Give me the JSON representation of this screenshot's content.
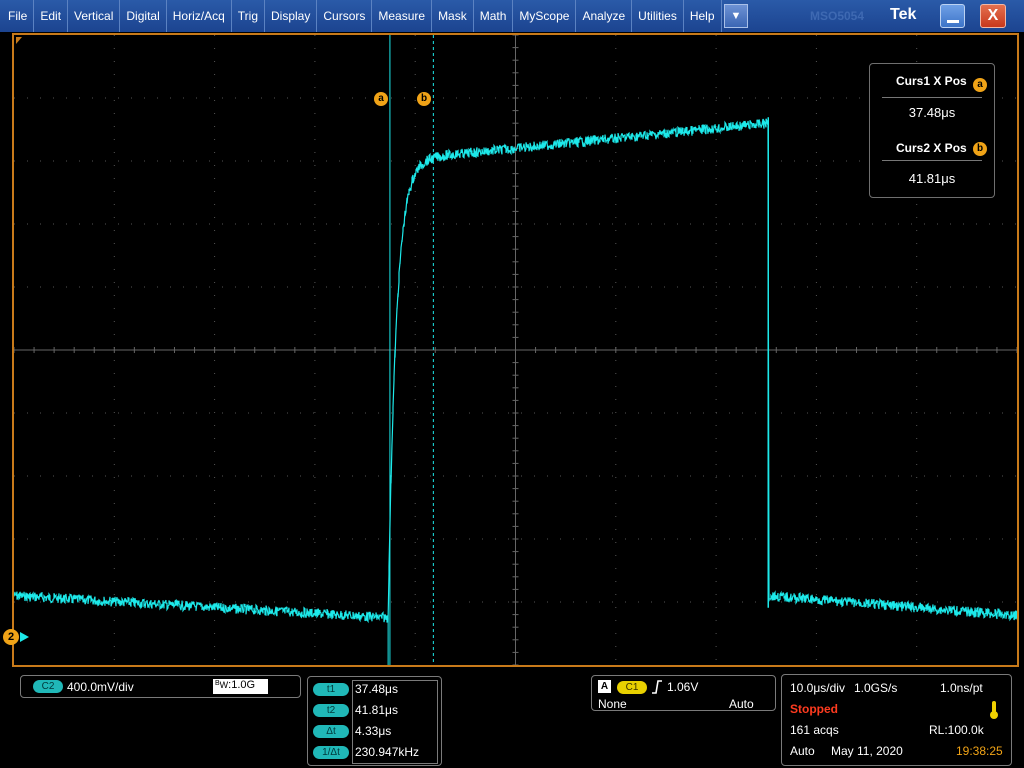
{
  "menu": {
    "items": [
      "File",
      "Edit",
      "Vertical",
      "Digital",
      "Horiz/Acq",
      "Trig",
      "Display",
      "Cursors",
      "Measure",
      "Mask",
      "Math",
      "MyScope",
      "Analyze",
      "Utilities",
      "Help"
    ],
    "dropdown_icon": "chevron-down-icon",
    "brand": "Tek",
    "brand_ghost": "MSO5054"
  },
  "colors": {
    "trace": "#1de9ea",
    "cursor_badge": "#f0a317",
    "border": "#c87a1a",
    "stopped": "#ff3b1f",
    "time": "#f0a317"
  },
  "cursors": {
    "a_label": "a",
    "b_label": "b",
    "curs1_title": "Curs1 X Pos",
    "curs1_value": "37.48μs",
    "curs2_title": "Curs2 X Pos",
    "curs2_value": "41.81μs"
  },
  "channel": {
    "marker": "2",
    "tag": "C2",
    "scale": "400.0mV/div",
    "bw_prefix": "B",
    "bw_sub": "W",
    "bw_value": ":1.0G"
  },
  "cursor_table": {
    "rows": [
      {
        "label": "t1",
        "value": "37.48μs"
      },
      {
        "label": "t2",
        "value": "41.81μs"
      },
      {
        "label": "Δt",
        "value": "4.33μs"
      },
      {
        "label": "1/Δt",
        "value": "230.947kHz"
      }
    ]
  },
  "trigger": {
    "mode_box": "A",
    "source": "C1",
    "slope_icon": "rising-edge-icon",
    "level": "1.06V",
    "coupling": "None",
    "auto_label": "Auto"
  },
  "acquisition": {
    "timebase": "10.0μs/div",
    "sample_rate": "1.0GS/s",
    "resolution": "1.0ns/pt",
    "state": "Stopped",
    "acqs": "161 acqs",
    "record_length": "RL:100.0k",
    "mode": "Auto",
    "date": "May 11, 2020",
    "time": "19:38:25",
    "thermo_icon": "thermometer-icon"
  },
  "waveform": {
    "time_per_div_us": 10,
    "cursor1_us": 37.48,
    "cursor2_us": 41.81,
    "edge_rise_us": 37.3,
    "edge_fall_us": 75.2,
    "low_level_div_start": -3.9,
    "low_level_div_end": -4.25,
    "high_level_div_after_rise": 3.0,
    "high_level_div_end": 3.6
  }
}
